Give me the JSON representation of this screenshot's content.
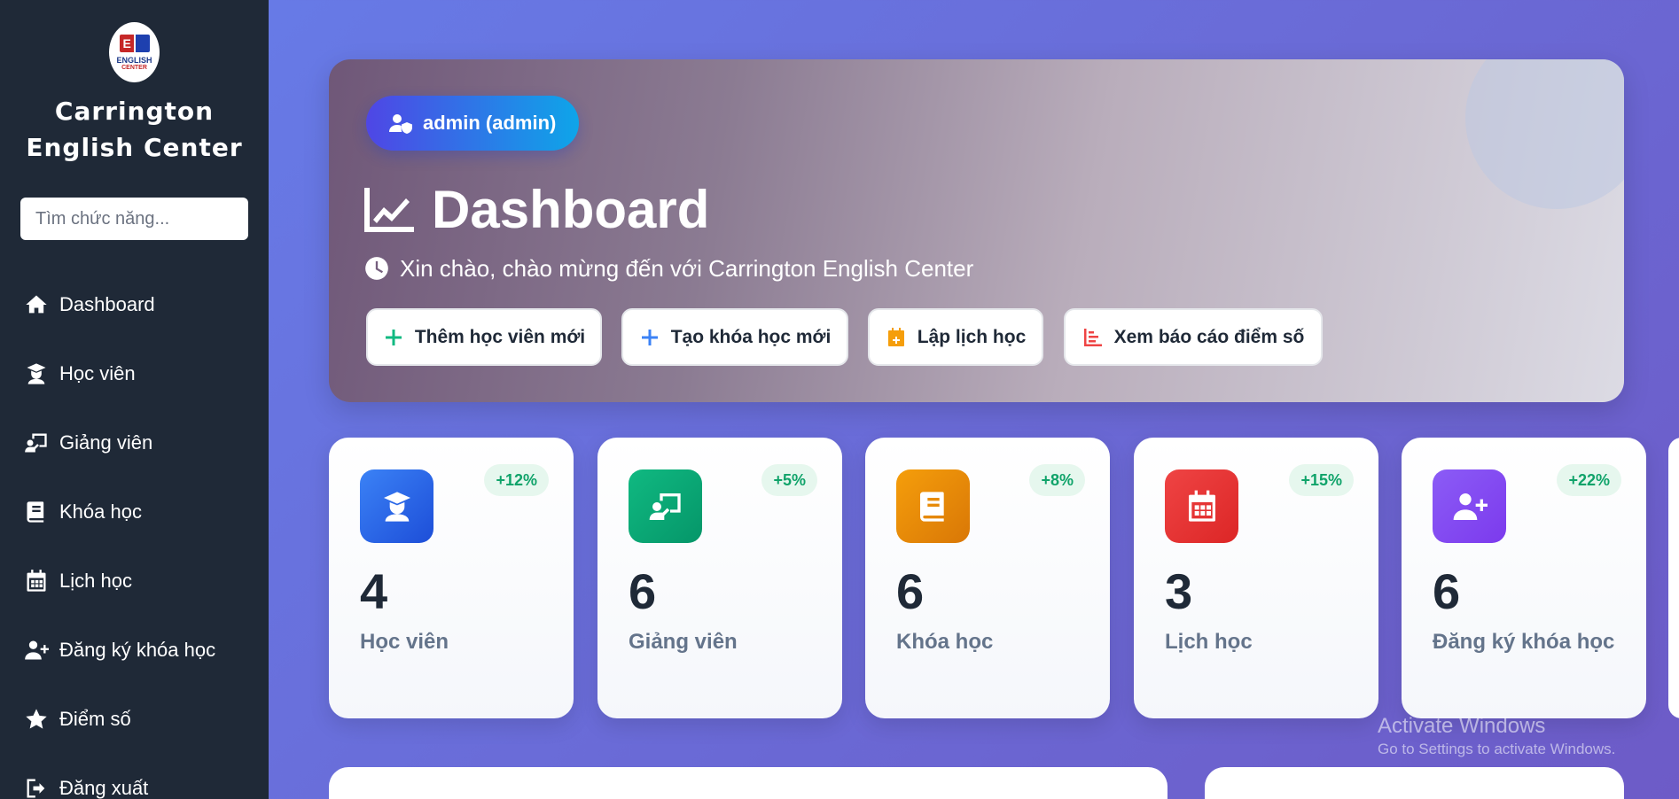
{
  "sidebar": {
    "logo": {
      "line1": "ENGLISH",
      "line2": "CENTER",
      "letter": "E"
    },
    "brand_line1": "Carrington",
    "brand_line2": "English Center",
    "search_placeholder": "Tìm chức năng...",
    "items": [
      {
        "label": "Dashboard",
        "icon": "home-icon"
      },
      {
        "label": "Học viên",
        "icon": "student-icon"
      },
      {
        "label": "Giảng viên",
        "icon": "teacher-icon"
      },
      {
        "label": "Khóa học",
        "icon": "book-icon"
      },
      {
        "label": "Lịch học",
        "icon": "calendar-icon"
      },
      {
        "label": "Đăng ký khóa học",
        "icon": "user-plus-icon"
      },
      {
        "label": "Điểm số",
        "icon": "star-icon"
      },
      {
        "label": "Đăng xuất",
        "icon": "logout-icon"
      }
    ]
  },
  "hero": {
    "user_badge": "admin (admin)",
    "title": "Dashboard",
    "subtitle": "Xin chào, chào mừng đến với Carrington English Center",
    "actions": [
      {
        "label": "Thêm học viên mới",
        "icon": "plus-icon",
        "color": "#10b981"
      },
      {
        "label": "Tạo khóa học mới",
        "icon": "plus-icon",
        "color": "#3b82f6"
      },
      {
        "label": "Lập lịch học",
        "icon": "calendar-plus-icon",
        "color": "#f59e0b"
      },
      {
        "label": "Xem báo cáo điểm số",
        "icon": "bar-chart-icon",
        "color": "#ef4444"
      }
    ]
  },
  "stats": [
    {
      "value": "4",
      "label": "Học viên",
      "change": "+12%",
      "icon": "student-icon",
      "color": "#2563eb"
    },
    {
      "value": "6",
      "label": "Giảng viên",
      "change": "+5%",
      "icon": "teacher-icon",
      "color": "#10b981"
    },
    {
      "value": "6",
      "label": "Khóa học",
      "change": "+8%",
      "icon": "book-icon",
      "color": "#f59e0b"
    },
    {
      "value": "3",
      "label": "Lịch học",
      "change": "+15%",
      "icon": "calendar-icon",
      "color": "#ef4444"
    },
    {
      "value": "6",
      "label": "Đăng ký khóa học",
      "change": "+22%",
      "icon": "user-plus-icon",
      "color": "#8b5cf6"
    }
  ],
  "watermark": {
    "line1": "Activate Windows",
    "line2": "Go to Settings to activate Windows."
  }
}
